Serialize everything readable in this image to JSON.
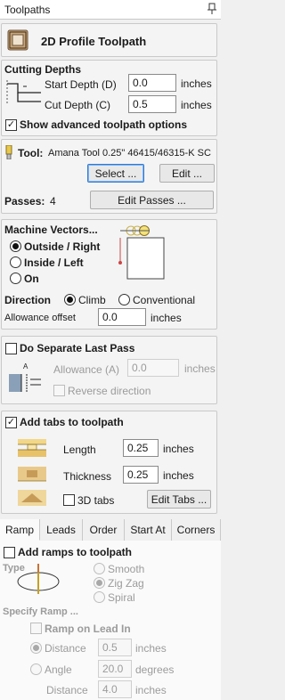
{
  "window": {
    "title": "Toolpaths"
  },
  "header": {
    "title": "2D Profile Toolpath"
  },
  "cutting_depths": {
    "heading": "Cutting Depths",
    "start_label": "Start Depth (D)",
    "start_value": "0.0",
    "cut_label": "Cut Depth (C)",
    "cut_value": "0.5",
    "units": "inches",
    "show_advanced_label": "Show advanced toolpath options",
    "show_advanced_checked": true
  },
  "tool": {
    "label": "Tool:",
    "name": "Amana Tool 0.25\" 46415/46315-K SC",
    "select_label": "Select ...",
    "edit_label": "Edit ...",
    "passes_label": "Passes:",
    "passes_value": "4",
    "edit_passes_label": "Edit Passes ..."
  },
  "machine_vectors": {
    "heading": "Machine Vectors...",
    "options": [
      "Outside / Right",
      "Inside / Left",
      "On"
    ],
    "selected": "Outside / Right",
    "direction_label": "Direction",
    "direction_options": [
      "Climb",
      "Conventional"
    ],
    "direction_selected": "Climb",
    "allowance_label": "Allowance offset",
    "allowance_value": "0.0",
    "units": "inches"
  },
  "last_pass": {
    "label": "Do Separate Last Pass",
    "checked": false,
    "allowance_label": "Allowance (A)",
    "allowance_value": "0.0",
    "units": "inches",
    "reverse_label": "Reverse direction"
  },
  "tabs_section": {
    "label": "Add tabs to toolpath",
    "checked": true,
    "length_label": "Length",
    "length_value": "0.25",
    "thickness_label": "Thickness",
    "thickness_value": "0.25",
    "units": "inches",
    "tabs3d_label": "3D tabs",
    "edit_tabs_label": "Edit Tabs ..."
  },
  "bottom_tabs": [
    "Ramp",
    "Leads",
    "Order",
    "Start At",
    "Corners"
  ],
  "active_tab": "Ramp",
  "ramp": {
    "label": "Add ramps to toolpath",
    "type_label": "Type",
    "types": [
      "Smooth",
      "Zig Zag",
      "Spiral"
    ],
    "type_selected": "Zig Zag",
    "specify_label": "Specify Ramp ...",
    "lead_in_label": "Ramp on Lead In",
    "distance_label": "Distance",
    "distance_value": "0.5",
    "angle_label": "Angle",
    "angle_value": "20.0",
    "angle_units": "degrees",
    "distance2_label": "Distance",
    "distance2_value": "4.0",
    "units": "inches"
  },
  "colors": {
    "accent": "#2f7bd6",
    "tool_yellow": "#e8c84a",
    "panel_border": "#c9c9c9"
  }
}
